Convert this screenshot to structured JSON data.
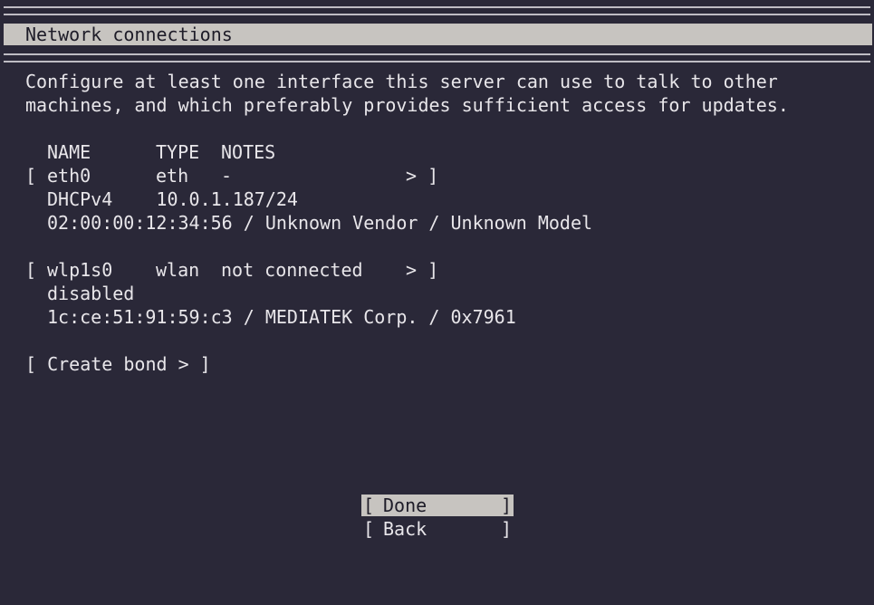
{
  "window": {
    "title": "Network connections"
  },
  "intro": {
    "line1": "Configure at least one interface this server can use to talk to other",
    "line2": "machines, and which preferably provides sufficient access for updates."
  },
  "table": {
    "headers": [
      "NAME",
      "TYPE",
      "NOTES"
    ],
    "interfaces": [
      {
        "open_bracket": "[",
        "name": "eth0",
        "type": "eth",
        "notes": "-",
        "close_bracket": "> ]",
        "detail1": "DHCPv4    10.0.1.187/24",
        "detail2": "02:00:00:12:34:56 / Unknown Vendor / Unknown Model"
      },
      {
        "open_bracket": "[",
        "name": "wlp1s0",
        "type": "wlan",
        "notes": "not connected",
        "close_bracket": "> ]",
        "detail1": "disabled",
        "detail2": "1c:ce:51:91:59:c3 / MEDIATEK Corp. / 0x7961"
      }
    ]
  },
  "create_bond": {
    "label": "[ Create bond > ]"
  },
  "buttons": {
    "done": "Done",
    "back": "Back",
    "open": "[",
    "close": "]"
  },
  "colors": {
    "background": "#2a2838",
    "highlight": "#c7c4c0",
    "text": "#e8e6ea"
  }
}
